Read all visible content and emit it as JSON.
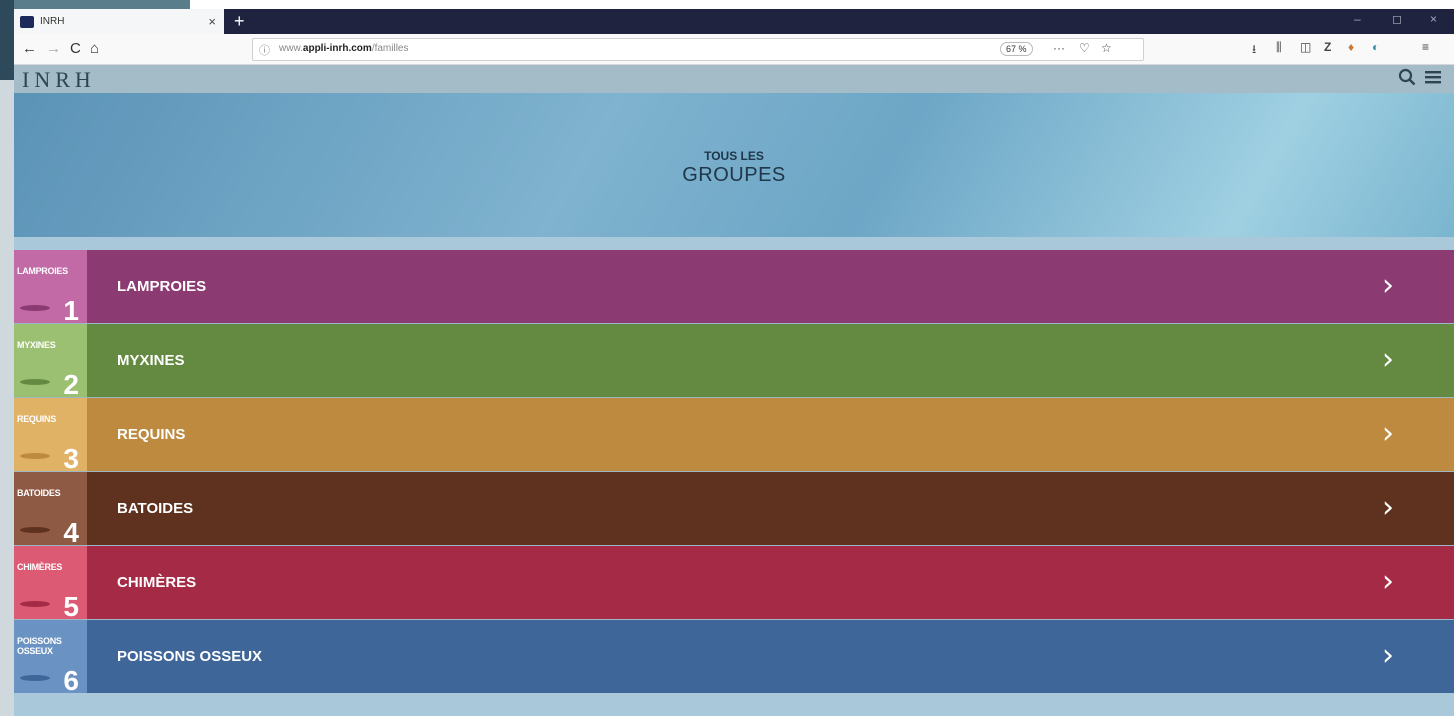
{
  "browser": {
    "tab_title": "INRH",
    "tab_close": "×",
    "new_tab": "+",
    "window_controls": [
      "–",
      "◻",
      "×"
    ],
    "nav": {
      "back": "←",
      "forward": "→",
      "reload": "C",
      "home": "⌂"
    },
    "url_info_icon": "ⓘ",
    "url_prefix": "www.",
    "url_domain": "appli-inrh.com",
    "url_path": "/familles",
    "zoom": "67 %",
    "url_actions": [
      "···",
      "♡",
      "☆"
    ],
    "toolbar_icons": [
      "⭳",
      "⫼",
      "◫",
      "Z",
      "♦",
      "◐",
      "≡"
    ]
  },
  "site": {
    "logo": "INRH",
    "search_icon": "search-icon",
    "menu_icon": "menu-icon"
  },
  "hero": {
    "line1": "TOUS LES",
    "line2": "GROUPES"
  },
  "groups": [
    {
      "label": "LAMPROIES",
      "thumb_label": "LAMPROIES",
      "number": "1",
      "color": "#8c3a72",
      "thumb_color": "#c16aa6"
    },
    {
      "label": "MYXINES",
      "thumb_label": "MYXINES",
      "number": "2",
      "color": "#648a42",
      "thumb_color": "#9cc072"
    },
    {
      "label": "REQUINS",
      "thumb_label": "REQUINS",
      "number": "3",
      "color": "#be8a40",
      "thumb_color": "#dfb266"
    },
    {
      "label": "BATOIDES",
      "thumb_label": "BATOIDES",
      "number": "4",
      "color": "#5e321f",
      "thumb_color": "#8e5a44"
    },
    {
      "label": "CHIMÈRES",
      "thumb_label": "CHIMÈRES",
      "number": "5",
      "color": "#a52a45",
      "thumb_color": "#dc5a74"
    },
    {
      "label": "POISSONS OSSEUX",
      "thumb_label": "POISSONS\nOSSEUX",
      "number": "6",
      "color": "#3f6698",
      "thumb_color": "#6a92c2"
    }
  ],
  "chevron": "›"
}
